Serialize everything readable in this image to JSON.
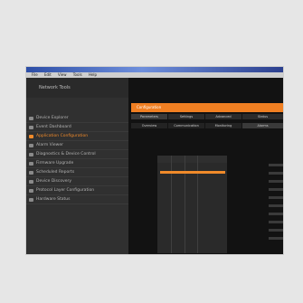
{
  "window": {
    "title": "",
    "menu": [
      "File",
      "Edit",
      "View",
      "Tools",
      "Help"
    ]
  },
  "left_panel": {
    "header": "Network Tools",
    "items": [
      {
        "label": "Device Explorer",
        "active": false
      },
      {
        "label": "Event Dashboard",
        "active": false
      },
      {
        "label": "Application Configuration",
        "active": true
      },
      {
        "label": "Alarm Viewer",
        "active": false
      },
      {
        "label": "Diagnostics & Device Control",
        "active": false
      },
      {
        "label": "Firmware Upgrade",
        "active": false
      },
      {
        "label": "Scheduled Reports",
        "active": false
      },
      {
        "label": "Device Discovery",
        "active": false
      },
      {
        "label": "Protocol Layer Configuration",
        "active": false
      },
      {
        "label": "Hardware Status",
        "active": false
      }
    ]
  },
  "content": {
    "header_label": "Configuration",
    "tabs_row1": [
      "Parameters",
      "Settings",
      "Advanced",
      "Status"
    ],
    "tabs_row2": [
      "Overview",
      "Communication",
      "Monitoring",
      "Alarms"
    ]
  },
  "colors": {
    "accent": "#f08a2a",
    "panel": "#303030",
    "content": "#121212",
    "page": "#e6e6e6"
  }
}
